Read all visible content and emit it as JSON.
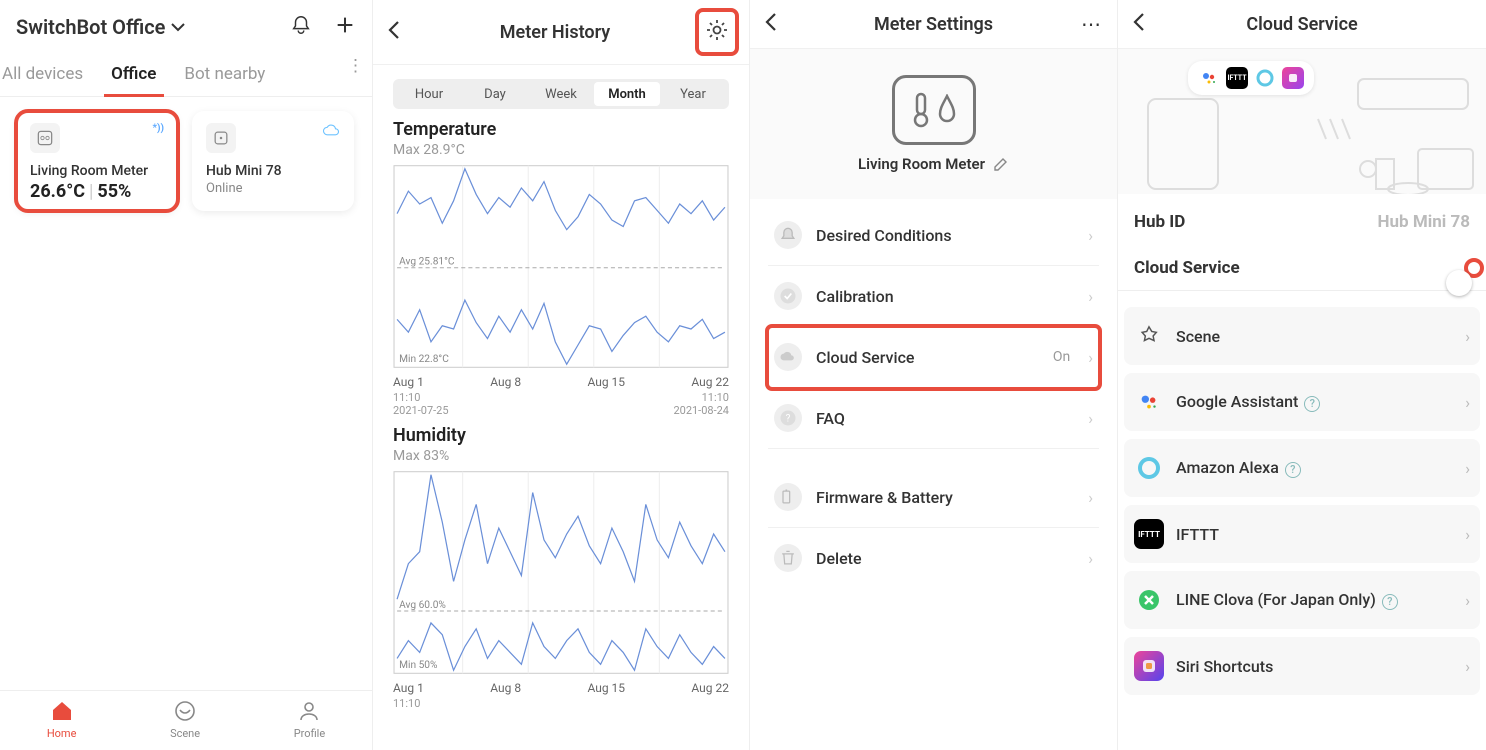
{
  "panel1": {
    "location": "SwitchBot Office",
    "tabs": [
      "All devices",
      "Office",
      "Bot nearby"
    ],
    "active_tab": 1,
    "devices": [
      {
        "icon": "meter",
        "bt": "*))",
        "name": "Living Room Meter",
        "temp": "26.6°C",
        "hum": "55%",
        "highlight": true
      },
      {
        "icon": "hub",
        "cloud": true,
        "name": "Hub Mini 78",
        "status": "Online"
      }
    ],
    "nav": [
      {
        "label": "Home",
        "icon": "home",
        "active": true
      },
      {
        "label": "Scene",
        "icon": "scene"
      },
      {
        "label": "Profile",
        "icon": "profile"
      }
    ]
  },
  "panel2": {
    "title": "Meter History",
    "segments": [
      "Hour",
      "Day",
      "Week",
      "Month",
      "Year"
    ],
    "active_segment": 3,
    "charts": [
      {
        "title": "Temperature",
        "max": "Max 28.9°C",
        "avg_label": "Avg 25.81°C",
        "min_label": "Min 22.8°C",
        "x_ticks": [
          "Aug 1",
          "Aug 8",
          "Aug 15",
          "Aug 22"
        ],
        "time_left_top": "11:10",
        "time_left_bottom": "2021-07-25",
        "time_right_top": "11:10",
        "time_right_bottom": "2021-08-24"
      },
      {
        "title": "Humidity",
        "max": "Max 83%",
        "avg_label": "Avg 60.0%",
        "min_label": "Min 50%",
        "x_ticks": [
          "Aug 1",
          "Aug 8",
          "Aug 15",
          "Aug 22"
        ],
        "time_left_top": "11:10"
      }
    ]
  },
  "chart_data": [
    {
      "type": "line",
      "title": "Temperature",
      "ylabel": "°C",
      "ylim": [
        22.8,
        28.9
      ],
      "avg": 25.81,
      "x": [
        "Aug 1",
        "Aug 8",
        "Aug 15",
        "Aug 22"
      ],
      "series": [
        {
          "name": "max",
          "values": [
            27.5,
            28.2,
            27.8,
            28.0,
            27.2,
            27.9,
            28.9,
            28.1,
            27.5,
            28.0,
            27.7,
            28.3,
            27.9,
            28.5,
            27.6,
            27.0,
            27.4,
            28.1,
            27.8,
            27.3,
            27.1,
            27.9,
            28.0,
            27.6,
            27.2,
            27.8,
            27.5,
            27.9,
            27.3,
            27.7
          ]
        },
        {
          "name": "min",
          "values": [
            24.2,
            23.8,
            24.5,
            23.5,
            24.0,
            23.9,
            24.8,
            24.1,
            23.6,
            24.3,
            23.8,
            24.5,
            23.9,
            24.7,
            23.5,
            22.8,
            23.4,
            24.0,
            23.9,
            23.2,
            23.7,
            24.1,
            24.3,
            23.8,
            23.5,
            24.0,
            23.9,
            24.2,
            23.6,
            23.8
          ]
        }
      ]
    },
    {
      "type": "line",
      "title": "Humidity",
      "ylabel": "%",
      "ylim": [
        50,
        83
      ],
      "avg": 60.0,
      "x": [
        "Aug 1",
        "Aug 8",
        "Aug 15",
        "Aug 22"
      ],
      "series": [
        {
          "name": "max",
          "values": [
            62,
            68,
            70,
            83,
            75,
            65,
            72,
            78,
            68,
            74,
            70,
            66,
            80,
            72,
            69,
            73,
            76,
            71,
            68,
            74,
            70,
            65,
            78,
            72,
            69,
            75,
            71,
            68,
            73,
            70
          ]
        },
        {
          "name": "min",
          "values": [
            52,
            55,
            53,
            58,
            56,
            50,
            54,
            57,
            52,
            55,
            53,
            51,
            58,
            54,
            52,
            55,
            57,
            53,
            51,
            55,
            53,
            50,
            57,
            54,
            52,
            56,
            53,
            51,
            54,
            52
          ]
        }
      ]
    }
  ],
  "panel3": {
    "title": "Meter Settings",
    "device_name": "Living Room Meter",
    "rows": [
      {
        "icon": "bell",
        "label": "Desired Conditions"
      },
      {
        "icon": "check",
        "label": "Calibration"
      },
      {
        "icon": "cloud",
        "label": "Cloud Service",
        "value": "On",
        "highlight": true
      },
      {
        "icon": "help",
        "label": "FAQ"
      },
      {
        "icon": "battery",
        "label": "Firmware & Battery",
        "gap": true
      },
      {
        "icon": "trash",
        "label": "Delete"
      }
    ]
  },
  "panel4": {
    "title": "Cloud Service",
    "hub_label": "Hub ID",
    "hub_value": "Hub Mini 78",
    "cloud_label": "Cloud Service",
    "toggle_on": true,
    "integrations": [
      {
        "icon": "scene",
        "label": "Scene",
        "color": "#555"
      },
      {
        "icon": "google",
        "label": "Google Assistant",
        "q": true
      },
      {
        "icon": "alexa",
        "label": "Amazon Alexa",
        "q": true
      },
      {
        "icon": "ifttt",
        "label": "IFTTT"
      },
      {
        "icon": "clova",
        "label": "LINE Clova (For Japan Only)",
        "q": true
      },
      {
        "icon": "siri",
        "label": "Siri Shortcuts"
      }
    ]
  }
}
